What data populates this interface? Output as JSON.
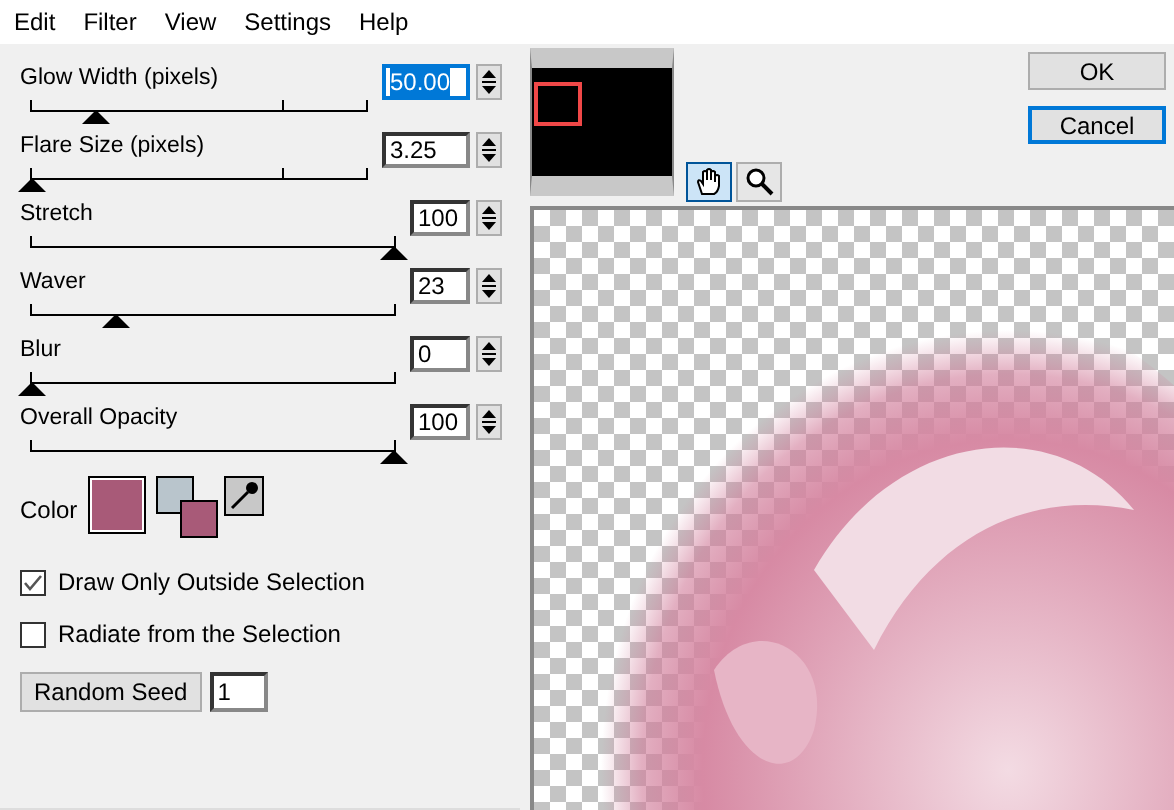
{
  "menu": [
    {
      "label": "Edit"
    },
    {
      "label": "Filter"
    },
    {
      "label": "View"
    },
    {
      "label": "Settings"
    },
    {
      "label": "Help"
    }
  ],
  "sliders": [
    {
      "label": "Glow Width (pixels)",
      "value": "50.00",
      "kind": "decimal",
      "level": 0.19,
      "focused": true
    },
    {
      "label": "Flare Size (pixels)",
      "value": "3.25",
      "kind": "decimal",
      "level": 0,
      "focused": false
    },
    {
      "label": "Stretch",
      "value": "100",
      "kind": "integer",
      "level": 1,
      "focused": false
    },
    {
      "label": "Waver",
      "value": "23",
      "kind": "integer",
      "level": 0.23,
      "focused": false
    },
    {
      "label": "Blur",
      "value": "0",
      "kind": "integer",
      "level": 0,
      "focused": false
    },
    {
      "label": "Overall Opacity",
      "value": "100",
      "kind": "integer",
      "level": 1,
      "focused": false
    }
  ],
  "color": {
    "label": "Color",
    "swatch": {
      "color": "#a85a78"
    },
    "background": {
      "color": "#b9c5cc"
    },
    "foreground": {
      "color": "#a85a78"
    }
  },
  "checkboxes": [
    {
      "label": "Draw Only Outside Selection",
      "checked": true
    },
    {
      "label": "Radiate from the Selection",
      "checked": false
    }
  ],
  "random_seed": {
    "button": "Random Seed",
    "value": "1"
  },
  "tools": [
    {
      "kind": "hand",
      "selected": true
    },
    {
      "kind": "zoom",
      "selected": false
    }
  ],
  "buttons": [
    {
      "label": "OK",
      "focused": false
    },
    {
      "label": "Cancel",
      "focused": true
    }
  ]
}
